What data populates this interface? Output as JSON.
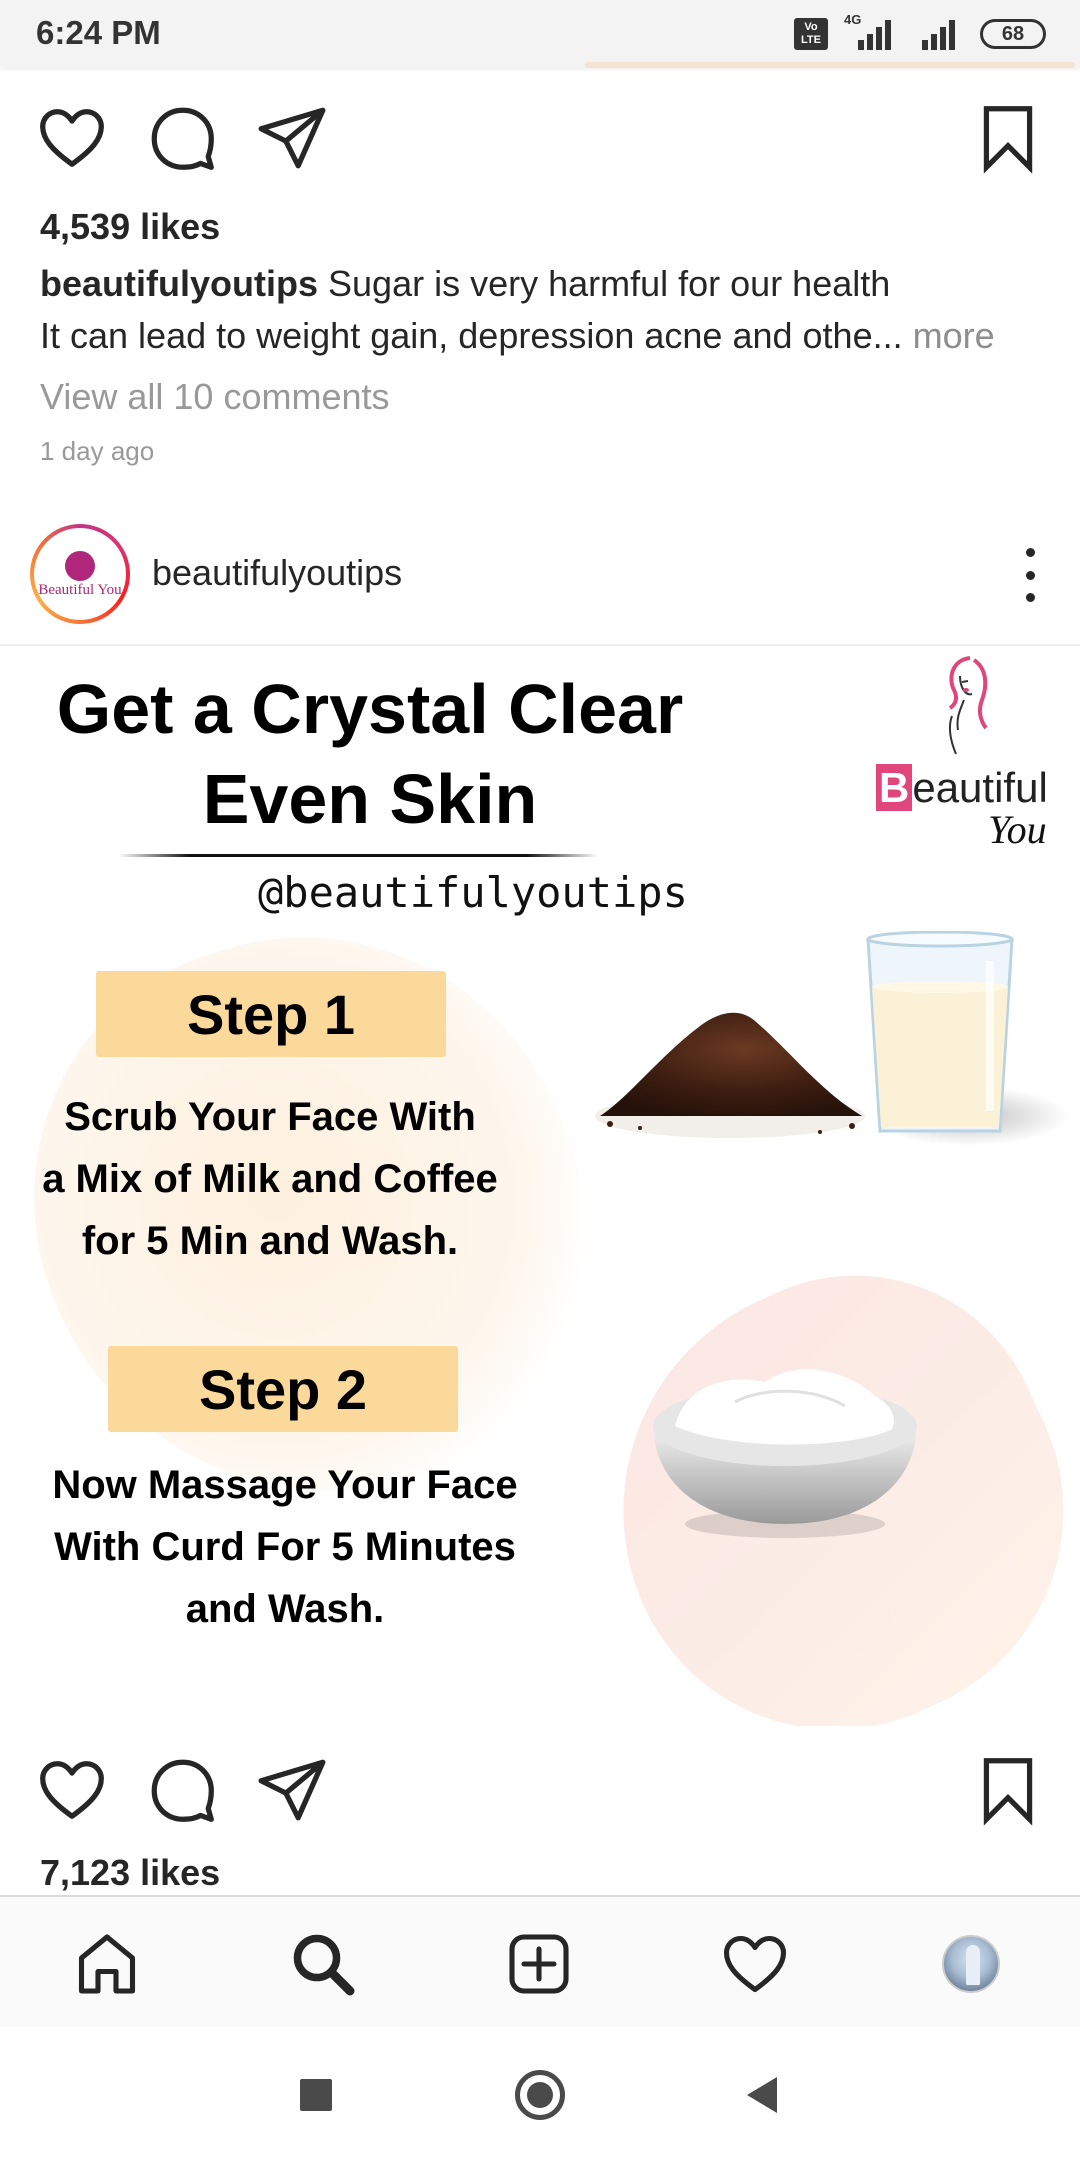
{
  "status_bar": {
    "time": "6:24 PM",
    "volte_label": "Vo LTE",
    "network_label": "4G",
    "battery": "68"
  },
  "post1": {
    "likes": "4,539 likes",
    "username": "beautifulyoutips",
    "caption_line1": "Sugar is very harmful for our health",
    "caption_line2": "It can lead to weight gain, depression acne and othe...",
    "more_label": " more",
    "view_comments": "View all 10 comments",
    "time_ago": "1 day ago"
  },
  "post2": {
    "avatar_text": "Beautiful You",
    "username": "beautifulyoutips",
    "image": {
      "title_line1": "Get a Crystal Clear",
      "title_line2": "Even  Skin",
      "handle": "@beautifulyoutips",
      "brand_name_rest": "eautiful",
      "brand_name_initial": "B",
      "brand_script": "You",
      "step1_label": "Step 1",
      "step1_text": "Scrub Your Face With\na Mix of Milk and Coffee\nfor 5 Min and Wash.",
      "step2_label": "Step 2",
      "step2_text": "Now Massage Your Face\nWith Curd For 5 Minutes\nand Wash."
    },
    "likes": "7,123 likes"
  },
  "icons": {
    "like": "heart-icon",
    "comment": "comment-bubble-icon",
    "share": "paper-plane-icon",
    "save": "bookmark-icon",
    "home": "home-icon",
    "search": "search-icon",
    "add": "add-post-icon",
    "activity": "heart-icon",
    "profile": "avatar"
  },
  "colors": {
    "step_badge": "#fbd99a",
    "brand_pink": "#e0457b",
    "muted_text": "#999999"
  }
}
